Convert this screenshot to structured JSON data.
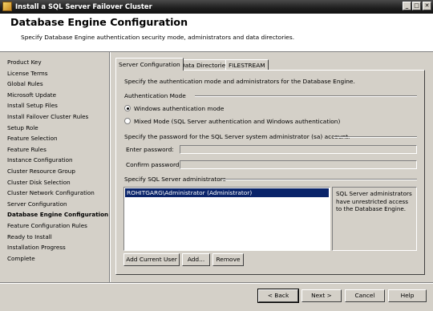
{
  "window": {
    "title": "Install a SQL Server Failover Cluster"
  },
  "header": {
    "title": "Database Engine Configuration",
    "subtitle": "Specify Database Engine authentication security mode, administrators and data directories."
  },
  "nav": {
    "items": [
      "Product Key",
      "License Terms",
      "Global Rules",
      "Microsoft Update",
      "Install Setup Files",
      "Install Failover Cluster Rules",
      "Setup Role",
      "Feature Selection",
      "Feature Rules",
      "Instance Configuration",
      "Cluster Resource Group",
      "Cluster Disk Selection",
      "Cluster Network Configuration",
      "Server Configuration",
      "Database Engine Configuration",
      "Feature Configuration Rules",
      "Ready to Install",
      "Installation Progress",
      "Complete"
    ],
    "active_index": 14
  },
  "tabs": [
    "Server Configuration",
    "Data Directories",
    "FILESTREAM"
  ],
  "form": {
    "intro": "Specify the authentication mode and administrators for the Database Engine.",
    "auth_group": "Authentication Mode",
    "radio_windows": "Windows authentication mode",
    "radio_mixed": "Mixed Mode (SQL Server authentication and Windows authentication)",
    "selected_mode": "windows",
    "sa_text": "Specify the password for the SQL Server system administrator (sa) account.",
    "enter_password_label": "Enter password:",
    "enter_password_value": "",
    "confirm_password_label": "Confirm password:",
    "confirm_password_value": "",
    "admins_group": "Specify SQL Server administrators",
    "admins": [
      "ROHITGARG\\Administrator (Administrator)"
    ],
    "admins_info": "SQL Server administrators have unrestricted access to the Database Engine.",
    "add_current_user": "Add Current User",
    "add": "Add...",
    "remove": "Remove"
  },
  "footer": {
    "back": "< Back",
    "next": "Next >",
    "cancel": "Cancel",
    "help": "Help"
  }
}
